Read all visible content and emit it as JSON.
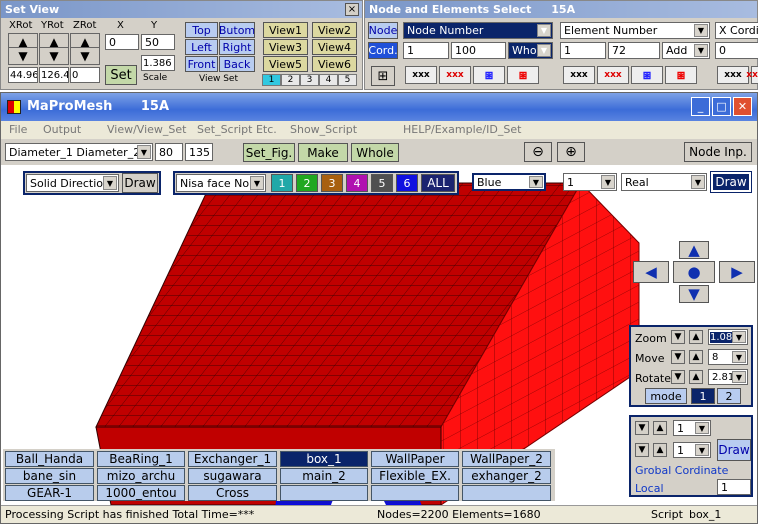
{
  "set_view": {
    "title": "Set View",
    "xrot_label": "XRot",
    "yrot_label": "YRot",
    "zrot_label": "ZRot",
    "x_label": "X",
    "y_label": "Y",
    "x_value": "0",
    "y_value": "50",
    "xrot_value": "44.96",
    "yrot_value": "126.4",
    "zrot_value": "0",
    "set_label": "Set",
    "scale_value": "1.386",
    "scale_label": "Scale",
    "views": [
      "Top",
      "Butom",
      "Left",
      "Right",
      "Front",
      "Back"
    ],
    "view_set_label": "View Set",
    "presets": [
      "View1",
      "View2",
      "View3",
      "View4",
      "View5",
      "View6"
    ],
    "preset_tabs": [
      "1",
      "2",
      "3",
      "4",
      "5"
    ],
    "close": "×"
  },
  "node_select": {
    "title": "Node and Elements Select",
    "version": "15A",
    "node_label": "Node",
    "cord_label": "Cord.",
    "node_dropdown": "Node Number",
    "node_from": "1",
    "node_to": "100",
    "node_range": "Whole",
    "elem_dropdown": "Element Number",
    "elem_from": "1",
    "elem_to": "72",
    "elem_mode": "Add",
    "coord_dropdown": "X Cordin",
    "coord_value": "0",
    "xxx": "xxx",
    "close": "×"
  },
  "main": {
    "app_title": "MaProMesh",
    "version": "15A",
    "menu": [
      "File",
      "Output",
      "View/View_Set",
      "Set_Script Etc.",
      "Show_Script",
      "HELP/Example/ID_Set"
    ],
    "diameter_select": "Diameter_1  Diameter_2",
    "dia_val1": "80",
    "dia_val2": "135",
    "set_fig": "Set_Fig.",
    "make": "Make",
    "whole": "Whole",
    "node_inp": "Node Inp.",
    "solid_select": "Solid Directio",
    "draw": "Draw",
    "nisa_select": "Nisa face No.",
    "face_buttons": [
      "1",
      "2",
      "3",
      "4",
      "5",
      "6"
    ],
    "all_label": "ALL",
    "color_select": "Blue",
    "num_select": "1",
    "real_select": "Real",
    "draw2": "Draw",
    "zoom_label": "Zoom",
    "zoom_value": "1.08",
    "move_label": "Move",
    "move_value": "8",
    "rotate_label": "Rotate",
    "rotate_value": "2.81",
    "mode_label": "mode",
    "mode_1": "1",
    "mode_2": "2",
    "sub_val1": "1",
    "sub_val2": "1",
    "sub_draw": "Draw",
    "global_coord": "Grobal Cordinate",
    "local_label": "Local",
    "local_value": "1",
    "scripts": [
      [
        "Ball_Handa",
        "BeaRing_1",
        "Exchanger_1",
        "box_1",
        "WallPaper",
        "WallPaper_2"
      ],
      [
        "bane_sin",
        "mizo_archu",
        "sugawara",
        "main_2",
        "Flexible_EX.",
        "exhanger_2"
      ],
      [
        "GEAR-1",
        "1000_entou",
        "Cross",
        "",
        "",
        ""
      ]
    ],
    "status_left": "Processing Script has finished  Total Time=***",
    "status_mid": "Nodes=2200  Elements=1680",
    "status_script": "Script",
    "status_name": "box_1"
  },
  "colors": {
    "title_blue": "#0a246a",
    "face_red": "#cc0000",
    "face_dark": "#a00000",
    "hole_blue": "#1010cc",
    "btn_blue": "#b8ccf0",
    "btn_green": "#c3d8a8"
  }
}
